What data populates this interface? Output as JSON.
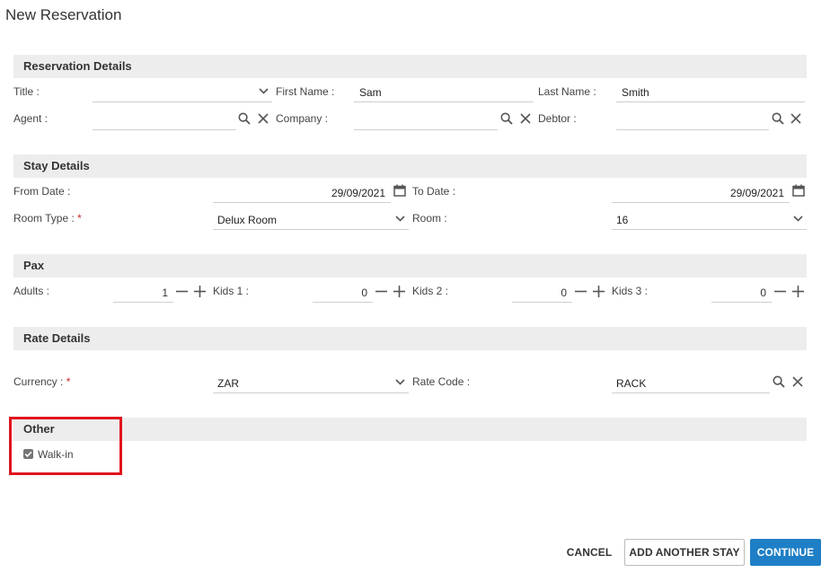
{
  "page": {
    "title": "New Reservation"
  },
  "reservation": {
    "header": "Reservation Details",
    "title_label": "Title :",
    "title_value": "",
    "first_name_label": "First Name :",
    "first_name_value": "Sam",
    "last_name_label": "Last Name :",
    "last_name_value": "Smith",
    "agent_label": "Agent :",
    "agent_value": "",
    "company_label": "Company :",
    "company_value": "",
    "debtor_label": "Debtor :",
    "debtor_value": ""
  },
  "stay": {
    "header": "Stay Details",
    "from_date_label": "From Date :",
    "from_date_value": "29/09/2021",
    "to_date_label": "To Date :",
    "to_date_value": "29/09/2021",
    "room_type_label": "Room Type :",
    "room_type_value": "Delux Room",
    "room_label": "Room :",
    "room_value": "16"
  },
  "pax": {
    "header": "Pax",
    "adults_label": "Adults :",
    "adults_value": "1",
    "kids1_label": "Kids 1 :",
    "kids1_value": "0",
    "kids2_label": "Kids 2 :",
    "kids2_value": "0",
    "kids3_label": "Kids 3 :",
    "kids3_value": "0"
  },
  "rate": {
    "header": "Rate Details",
    "currency_label": "Currency :",
    "currency_value": "ZAR",
    "rate_code_label": "Rate Code :",
    "rate_code_value": "RACK"
  },
  "other": {
    "header": "Other",
    "walk_in_label": "Walk-in",
    "walk_in_checked": true
  },
  "required_marker": "*",
  "buttons": {
    "cancel": "CANCEL",
    "add_another_stay": "ADD ANOTHER STAY",
    "continue": "CONTINUE"
  },
  "colors": {
    "primary": "#1e7fc6",
    "section_bg": "#ededed",
    "highlight": "#e0141e",
    "required": "#c62828"
  }
}
